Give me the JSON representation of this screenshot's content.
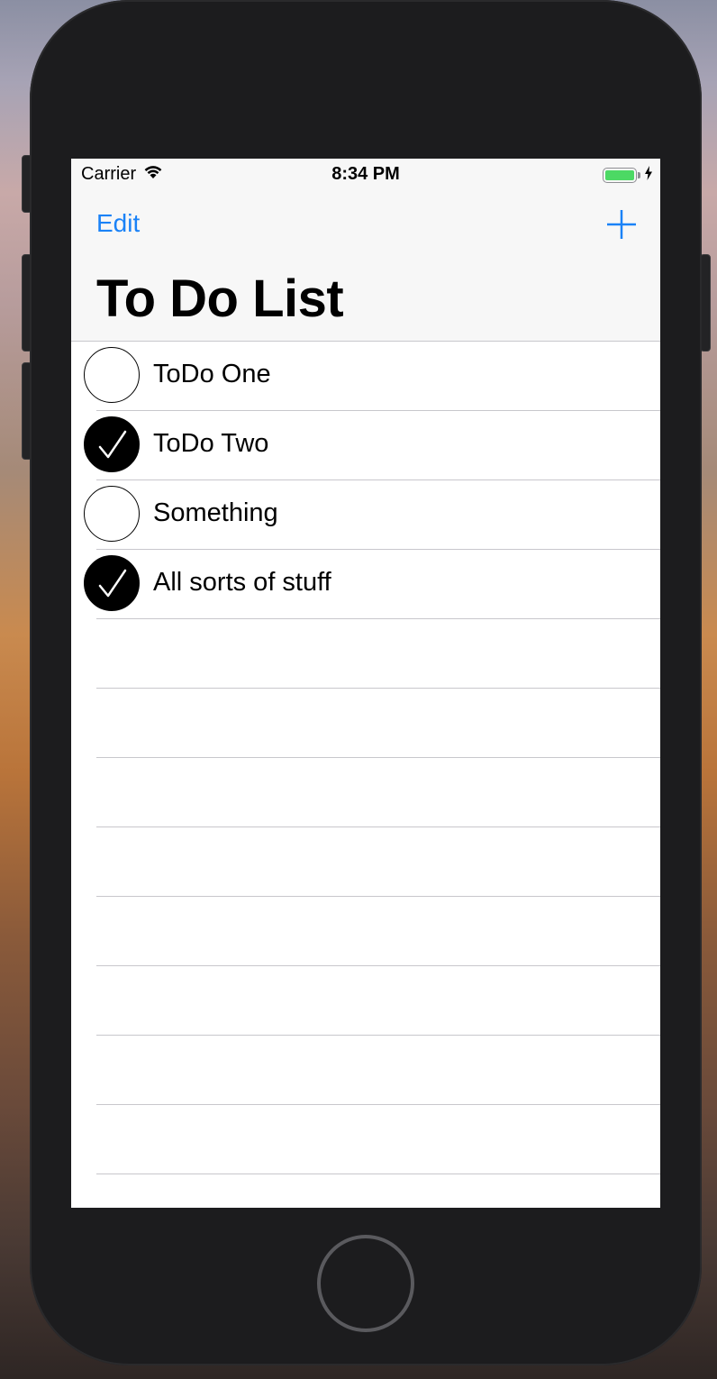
{
  "statusbar": {
    "carrier": "Carrier",
    "wifi_icon": "wifi-icon",
    "time": "8:34 PM",
    "battery_icon": "battery-charging-icon",
    "battery_color": "#4cd964"
  },
  "navbar": {
    "edit_label": "Edit",
    "add_icon": "plus-icon",
    "title": "To Do List",
    "accent_color": "#1a82f7"
  },
  "todos": [
    {
      "title": "ToDo One",
      "completed": false
    },
    {
      "title": "ToDo Two",
      "completed": true
    },
    {
      "title": "Something",
      "completed": false
    },
    {
      "title": "All sorts of stuff",
      "completed": true
    }
  ],
  "empty_rows": 8
}
